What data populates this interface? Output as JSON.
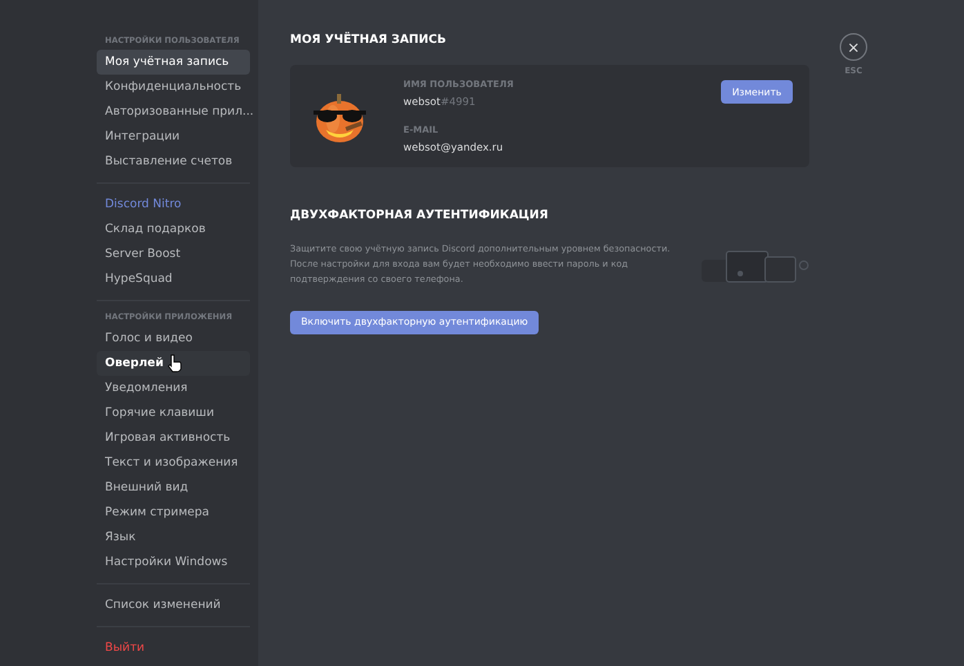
{
  "sidebar": {
    "sections": [
      {
        "header": "НАСТРОЙКИ ПОЛЬЗОВАТЕЛЯ",
        "items": [
          {
            "label": "Моя учётная запись",
            "kind": "normal",
            "selected": true,
            "hovered": false
          },
          {
            "label": "Конфиденциальность",
            "kind": "normal",
            "selected": false,
            "hovered": false
          },
          {
            "label": "Авторизованные прил...",
            "kind": "normal",
            "selected": false,
            "hovered": false
          },
          {
            "label": "Интеграции",
            "kind": "normal",
            "selected": false,
            "hovered": false
          },
          {
            "label": "Выставление счетов",
            "kind": "normal",
            "selected": false,
            "hovered": false
          }
        ]
      },
      {
        "items": [
          {
            "label": "Discord Nitro",
            "kind": "nitro",
            "selected": false,
            "hovered": false
          },
          {
            "label": "Склад подарков",
            "kind": "normal",
            "selected": false,
            "hovered": false
          },
          {
            "label": "Server Boost",
            "kind": "normal",
            "selected": false,
            "hovered": false
          },
          {
            "label": "HypeSquad",
            "kind": "normal",
            "selected": false,
            "hovered": false
          }
        ]
      },
      {
        "header": "НАСТРОЙКИ ПРИЛОЖЕНИЯ",
        "items": [
          {
            "label": "Голос и видео",
            "kind": "normal",
            "selected": false,
            "hovered": false
          },
          {
            "label": "Оверлей",
            "kind": "normal",
            "selected": false,
            "hovered": true
          },
          {
            "label": "Уведомления",
            "kind": "normal",
            "selected": false,
            "hovered": false
          },
          {
            "label": "Горячие клавиши",
            "kind": "normal",
            "selected": false,
            "hovered": false
          },
          {
            "label": "Игровая активность",
            "kind": "normal",
            "selected": false,
            "hovered": false
          },
          {
            "label": "Текст и изображения",
            "kind": "normal",
            "selected": false,
            "hovered": false
          },
          {
            "label": "Внешний вид",
            "kind": "normal",
            "selected": false,
            "hovered": false
          },
          {
            "label": "Режим стримера",
            "kind": "normal",
            "selected": false,
            "hovered": false
          },
          {
            "label": "Язык",
            "kind": "normal",
            "selected": false,
            "hovered": false
          },
          {
            "label": "Настройки Windows",
            "kind": "normal",
            "selected": false,
            "hovered": false
          }
        ]
      },
      {
        "items": [
          {
            "label": "Список изменений",
            "kind": "normal",
            "selected": false,
            "hovered": false
          }
        ]
      },
      {
        "items": [
          {
            "label": "Выйти",
            "kind": "danger",
            "selected": false,
            "hovered": false
          }
        ]
      }
    ]
  },
  "account": {
    "title": "МОЯ УЧЁТНАЯ ЗАПИСЬ",
    "username_label": "ИМЯ ПОЛЬЗОВАТЕЛЯ",
    "username": "websot",
    "discriminator": "#4991",
    "email_label": "E-MAIL",
    "email": "websot@yandex.ru",
    "edit_button": "Изменить"
  },
  "close": {
    "glyph": "×",
    "label": "ESC"
  },
  "two_factor": {
    "title": "ДВУХФАКТОРНАЯ АУТЕНТИФИКАЦИЯ",
    "description": "Защитите свою учётную запись Discord дополнительным уровнем безопасности. После настройки для входа вам будет необходимо ввести пароль и код подтверждения со своего телефона.",
    "button": "Включить двухфакторную аутентификацию"
  }
}
